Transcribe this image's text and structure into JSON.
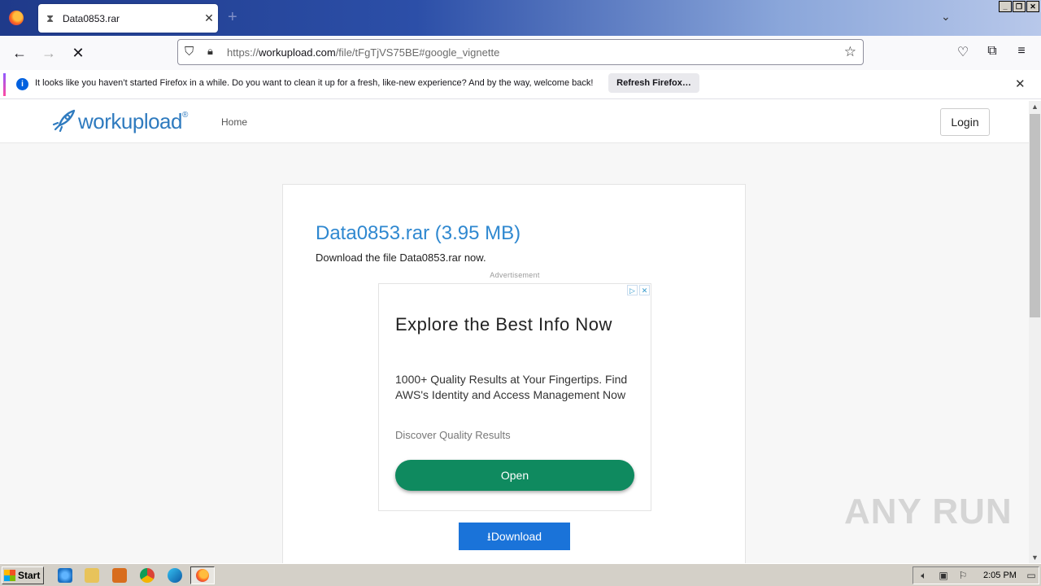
{
  "browser": {
    "tab_title": "Data0853.rar",
    "url_prefix": "https://",
    "url_domain": "workupload.com",
    "url_path": "/file/tFgTjVS75BE#google_vignette",
    "notification_message": "It looks like you haven’t started Firefox in a while. Do you want to clean it up for a fresh, like-new experience? And by the way, welcome back!",
    "notification_button": "Refresh Firefox…"
  },
  "site": {
    "logo_text": "workupload",
    "logo_reg": "®",
    "nav_home": "Home",
    "login_label": "Login"
  },
  "file": {
    "title": "Data0853.rar (3.95 MB)",
    "subtitle": "Download the file Data0853.rar now.",
    "ad_label": "Advertisement",
    "download_label": "Download"
  },
  "ad": {
    "headline": "Explore the Best Info Now",
    "description": "1000+ Quality Results at Your Fingertips. Find AWS's Identity and Access Management Now",
    "discover": "Discover Quality Results",
    "open_label": "Open"
  },
  "watermark": "ANY RUN",
  "taskbar": {
    "start_label": "Start",
    "clock": "2:05 PM"
  },
  "colors": {
    "accent_blue": "#2f88d0",
    "download_blue": "#1a73d9",
    "ad_green": "#0f8a5f"
  }
}
